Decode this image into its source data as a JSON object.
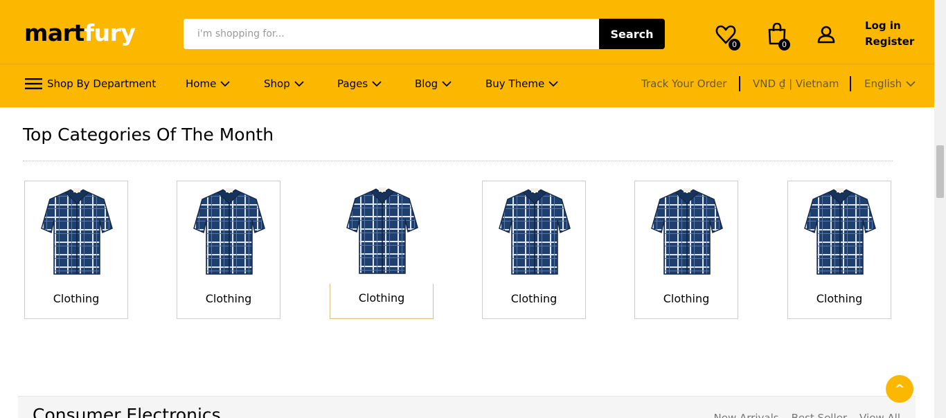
{
  "header": {
    "logo_dark": "mart",
    "logo_light": "fury",
    "search_placeholder": "i'm shopping for...",
    "search_button": "Search",
    "wishlist_count": "0",
    "cart_count": "0",
    "login_label": "Log in",
    "register_label": "Register"
  },
  "nav": {
    "department": "Shop By Department",
    "items": [
      {
        "label": "Home"
      },
      {
        "label": "Shop"
      },
      {
        "label": "Pages"
      },
      {
        "label": "Blog"
      },
      {
        "label": "Buy Theme"
      }
    ],
    "track_order": "Track Your Order",
    "currency": "VND ₫ | Vietnam",
    "language": "English"
  },
  "categories": {
    "title": "Top Categories Of The Month",
    "items": [
      {
        "label": "Clothing"
      },
      {
        "label": "Clothing"
      },
      {
        "label": "Clothing"
      },
      {
        "label": "Clothing"
      },
      {
        "label": "Clothing"
      },
      {
        "label": "Clothing"
      }
    ]
  },
  "section2": {
    "title": "Consumer Electronics",
    "links": [
      "New Arrivals",
      "Best Seller",
      "View All"
    ]
  },
  "back_to_top": "^",
  "colors": {
    "brand": "#fcb800",
    "text": "#000000",
    "shirt_blue": "#1f3f6e"
  },
  "icons": {
    "wishlist": "heart-icon",
    "cart": "shopping-bag-icon",
    "user": "user-icon",
    "menu": "hamburger-icon",
    "chevron": "chevron-down-icon"
  }
}
